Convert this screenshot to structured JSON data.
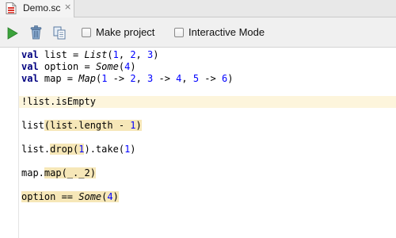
{
  "tab": {
    "label": "Demo.sc",
    "close": "×"
  },
  "toolbar": {
    "checkboxes": [
      {
        "label": "Make project",
        "checked": false
      },
      {
        "label": "Interactive Mode",
        "checked": false
      }
    ]
  },
  "icons": [
    "scala-file-icon",
    "run-icon",
    "trash-icon",
    "copy-icon",
    "close-icon"
  ],
  "colors": {
    "keyword": "#000080",
    "number": "#0000ff",
    "result_highlight": "#f6e7b8",
    "current_line": "#fdf5dc"
  },
  "code": {
    "l1_kw": "val",
    "l1_a": " list = ",
    "l1_fn": "List",
    "l1_b": "(",
    "l1_n1": "1",
    "l1_c": ", ",
    "l1_n2": "2",
    "l1_d": ", ",
    "l1_n3": "3",
    "l1_e": ")",
    "l2_kw": "val",
    "l2_a": " option = ",
    "l2_fn": "Some",
    "l2_b": "(",
    "l2_n1": "4",
    "l2_c": ")",
    "l3_kw": "val",
    "l3_a": " map = ",
    "l3_fn": "Map",
    "l3_b": "(",
    "l3_n1": "1",
    "l3_c": " -> ",
    "l3_n2": "2",
    "l3_d": ", ",
    "l3_n3": "3",
    "l3_e": " -> ",
    "l3_n4": "4",
    "l3_f": ", ",
    "l3_n5": "5",
    "l3_g": " -> ",
    "l3_n6": "6",
    "l3_h": ")",
    "l5": "!list.isEmpty",
    "l7_a": "list",
    "l7_b": "(list.length - ",
    "l7_n": "1",
    "l7_c": ")",
    "l9_a": "list.",
    "l9_b": "drop(",
    "l9_n1": "1",
    "l9_c": ").take(",
    "l9_n2": "1",
    "l9_d": ")",
    "l11_a": "map.",
    "l11_b": "map(_._2)",
    "l13_a": "option == ",
    "l13_fn": "Some",
    "l13_b": "(",
    "l13_n": "4",
    "l13_c": ")"
  }
}
